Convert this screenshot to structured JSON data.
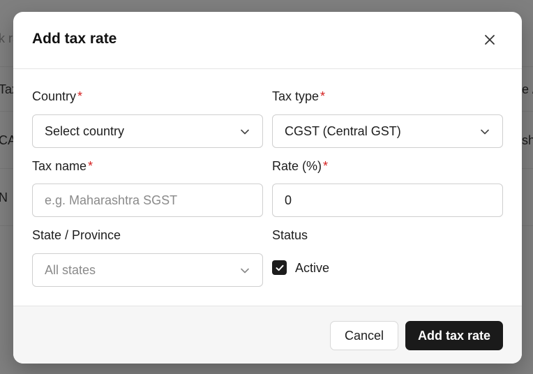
{
  "background": {
    "fragments": [
      "k ra",
      "Tax",
      "CA",
      "N",
      "e /",
      "sh"
    ]
  },
  "modal": {
    "title": "Add tax rate",
    "close_icon": "close-icon",
    "required_marker": "*",
    "fields": {
      "country": {
        "label": "Country",
        "value": "Select country"
      },
      "tax_type": {
        "label": "Tax type",
        "value": "CGST (Central GST)"
      },
      "tax_name": {
        "label": "Tax name",
        "placeholder": "e.g. Maharashtra SGST",
        "value": ""
      },
      "rate": {
        "label": "Rate (%)",
        "value": "0"
      },
      "state": {
        "label": "State / Province",
        "value": "All states"
      },
      "status": {
        "label": "Status",
        "checkbox_label": "Active",
        "checked": true
      }
    },
    "footer": {
      "cancel_label": "Cancel",
      "submit_label": "Add tax rate"
    }
  },
  "colors": {
    "required": "#d42020",
    "primary": "#1a1a1a"
  }
}
